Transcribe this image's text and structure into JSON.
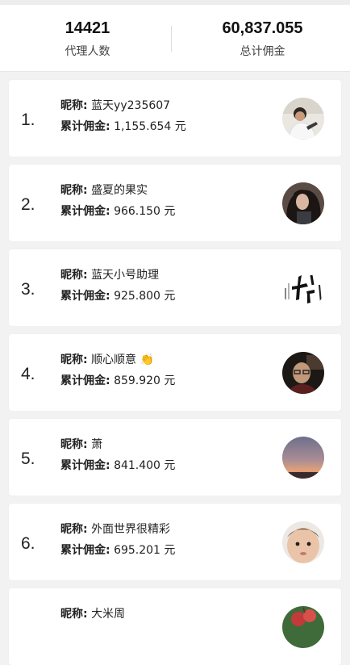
{
  "summary": {
    "agent_count": "14421",
    "agent_count_label": "代理人数",
    "total_commission": "60,837.055",
    "total_commission_label": "总计佣金"
  },
  "labels": {
    "nickname": "昵称:",
    "total": "累计佣金:",
    "unit": "元"
  },
  "ranking": [
    {
      "rank": "1.",
      "nickname": "蓝天yy235607",
      "amount": "1,155.654",
      "avatar": "avatar-man-white-shirt"
    },
    {
      "rank": "2.",
      "nickname": "盛夏的果实",
      "amount": "966.150",
      "avatar": "avatar-woman-dark-hair"
    },
    {
      "rank": "3.",
      "nickname": "蓝天小号助理",
      "amount": "925.800",
      "avatar": "avatar-calligraphy"
    },
    {
      "rank": "4.",
      "nickname": "顺心顺意 👏",
      "amount": "859.920",
      "avatar": "avatar-man-glasses"
    },
    {
      "rank": "5.",
      "nickname": "萧",
      "amount": "841.400",
      "avatar": "avatar-sunset-sky"
    },
    {
      "rank": "6.",
      "nickname": "外面世界很精彩",
      "amount": "695.201",
      "avatar": "avatar-child-face"
    },
    {
      "rank": "",
      "nickname": "大米周",
      "amount": "",
      "avatar": "avatar-fruit"
    }
  ]
}
